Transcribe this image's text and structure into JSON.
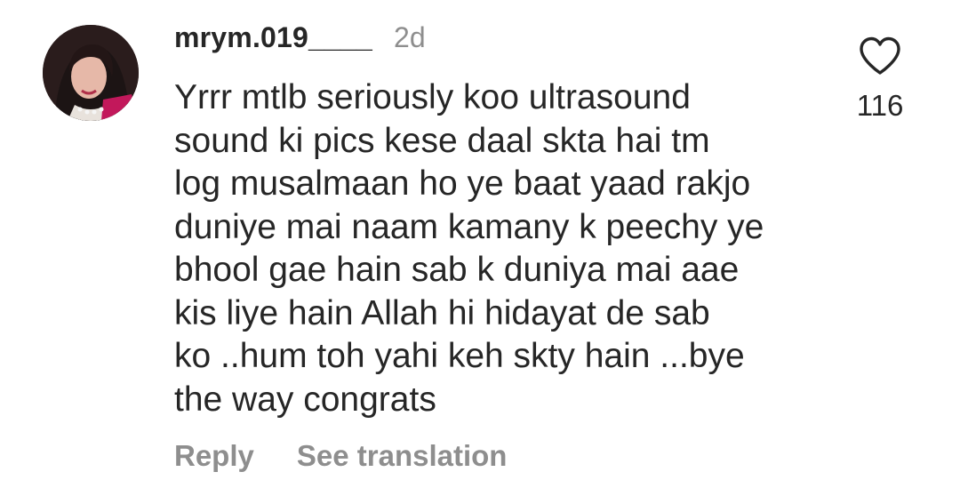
{
  "comment": {
    "username": "mrym.019____",
    "timestamp": "2d",
    "text": "Yrrr mtlb seriously koo ultrasound\nsound ki pics kese daal skta hai tm\nlog musalmaan ho ye baat yaad rakjo\nduniye mai naam kamany k peechy ye\nbhool gae hain sab k duniya mai aae\nkis liye hain Allah hi hidayat de sab\nko ..hum toh yahi keh skty hain ...bye\nthe way congrats",
    "like_count": "116",
    "like_icon": "heart-outline-icon"
  },
  "actions": {
    "reply_label": "Reply",
    "translate_label": "See translation"
  },
  "colors": {
    "primary_text": "#262626",
    "secondary_text": "#8e8e8e",
    "background": "#ffffff"
  }
}
